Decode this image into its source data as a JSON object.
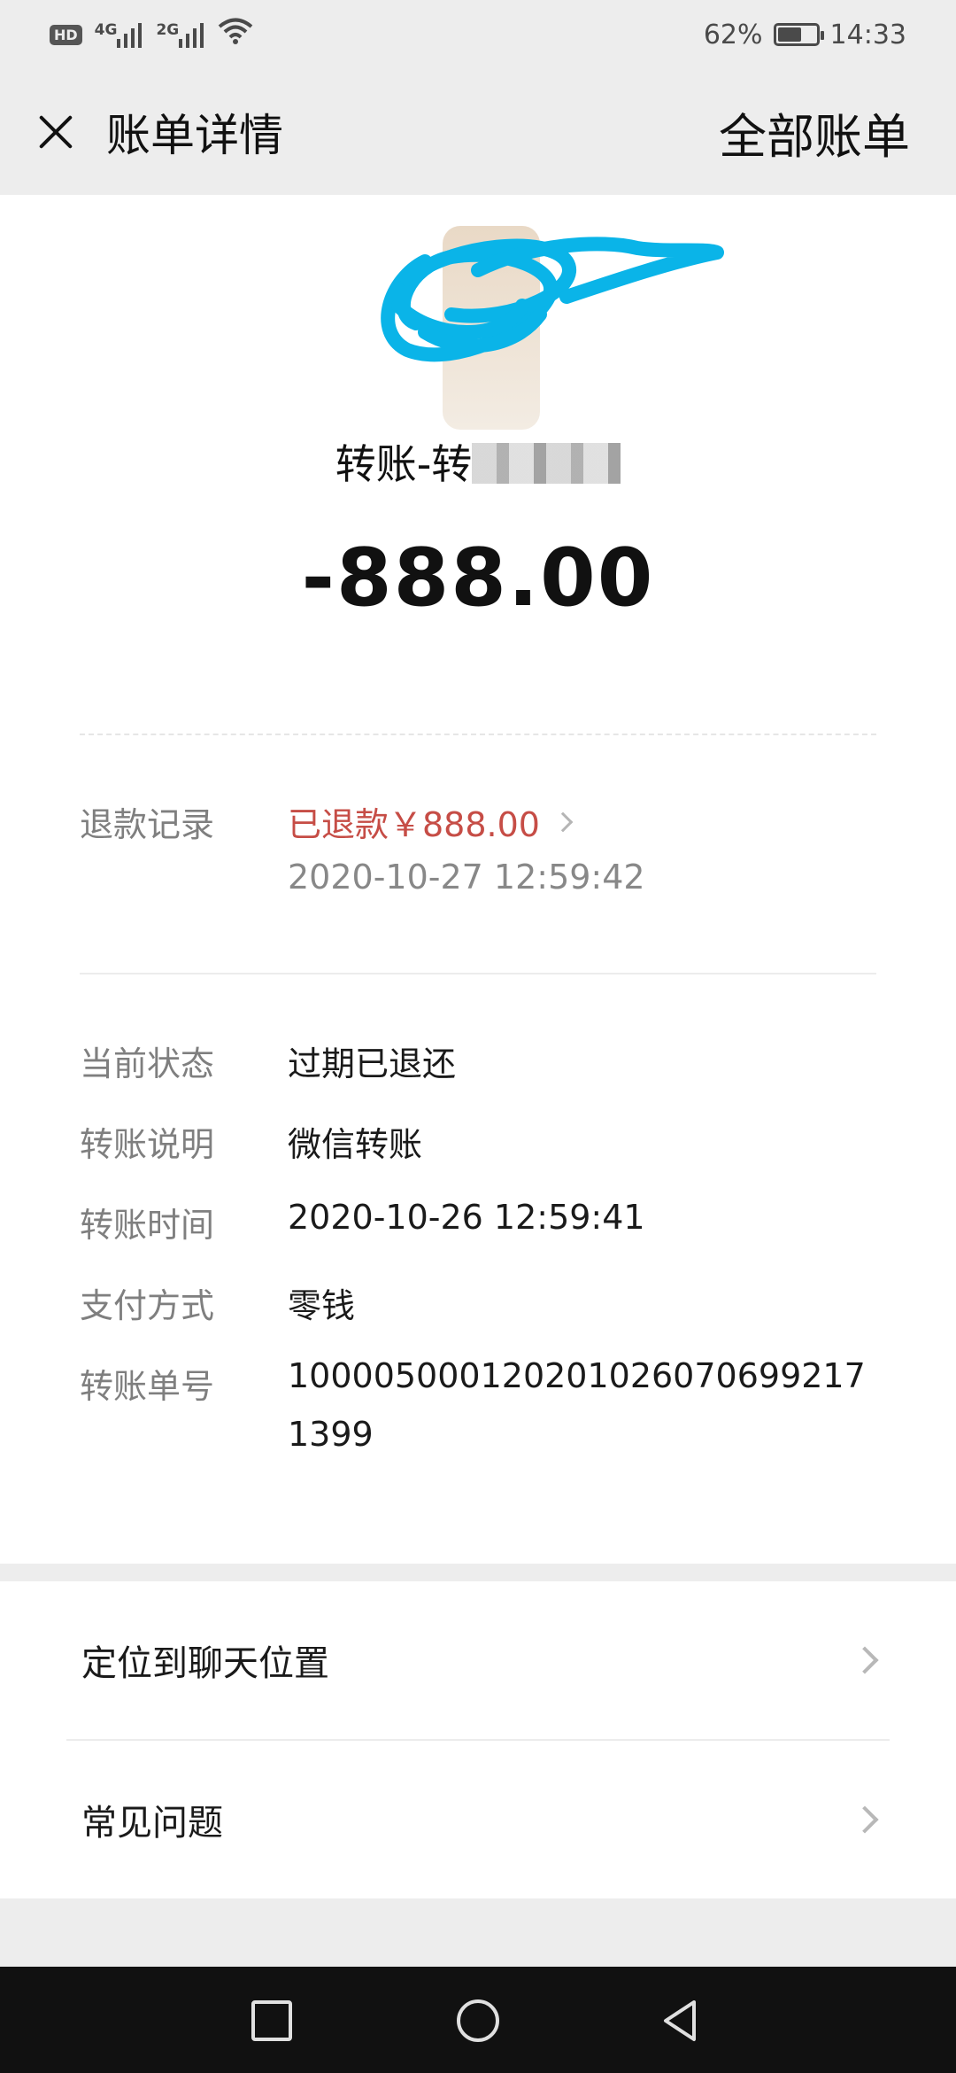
{
  "status_bar": {
    "hd_badge": "HD",
    "signal_1_label": "4G",
    "signal_2_label": "2G",
    "battery_percent": "62%",
    "battery_level": 0.62,
    "time": "14:33"
  },
  "nav": {
    "title": "账单详情",
    "right_action": "全部账单"
  },
  "bill": {
    "payee_prefix": "转账-转",
    "amount": "-888.00"
  },
  "refund": {
    "label": "退款记录",
    "status": "已退款￥888.00",
    "time": "2020-10-27 12:59:42"
  },
  "details": [
    {
      "label": "当前状态",
      "value": "过期已退还"
    },
    {
      "label": "转账说明",
      "value": "微信转账"
    },
    {
      "label": "转账时间",
      "value": "2020-10-26 12:59:41"
    },
    {
      "label": "支付方式",
      "value": "零钱"
    },
    {
      "label": "转账单号",
      "value": "100005000120201026070699217 1399"
    }
  ],
  "actions": [
    {
      "label": "定位到聊天位置"
    },
    {
      "label": "常见问题"
    }
  ],
  "colors": {
    "background": "#ededed",
    "card": "#ffffff",
    "refund_red": "#c64d46",
    "label_gray": "#7f7f7f",
    "scribble_blue": "#0ab4e8"
  }
}
